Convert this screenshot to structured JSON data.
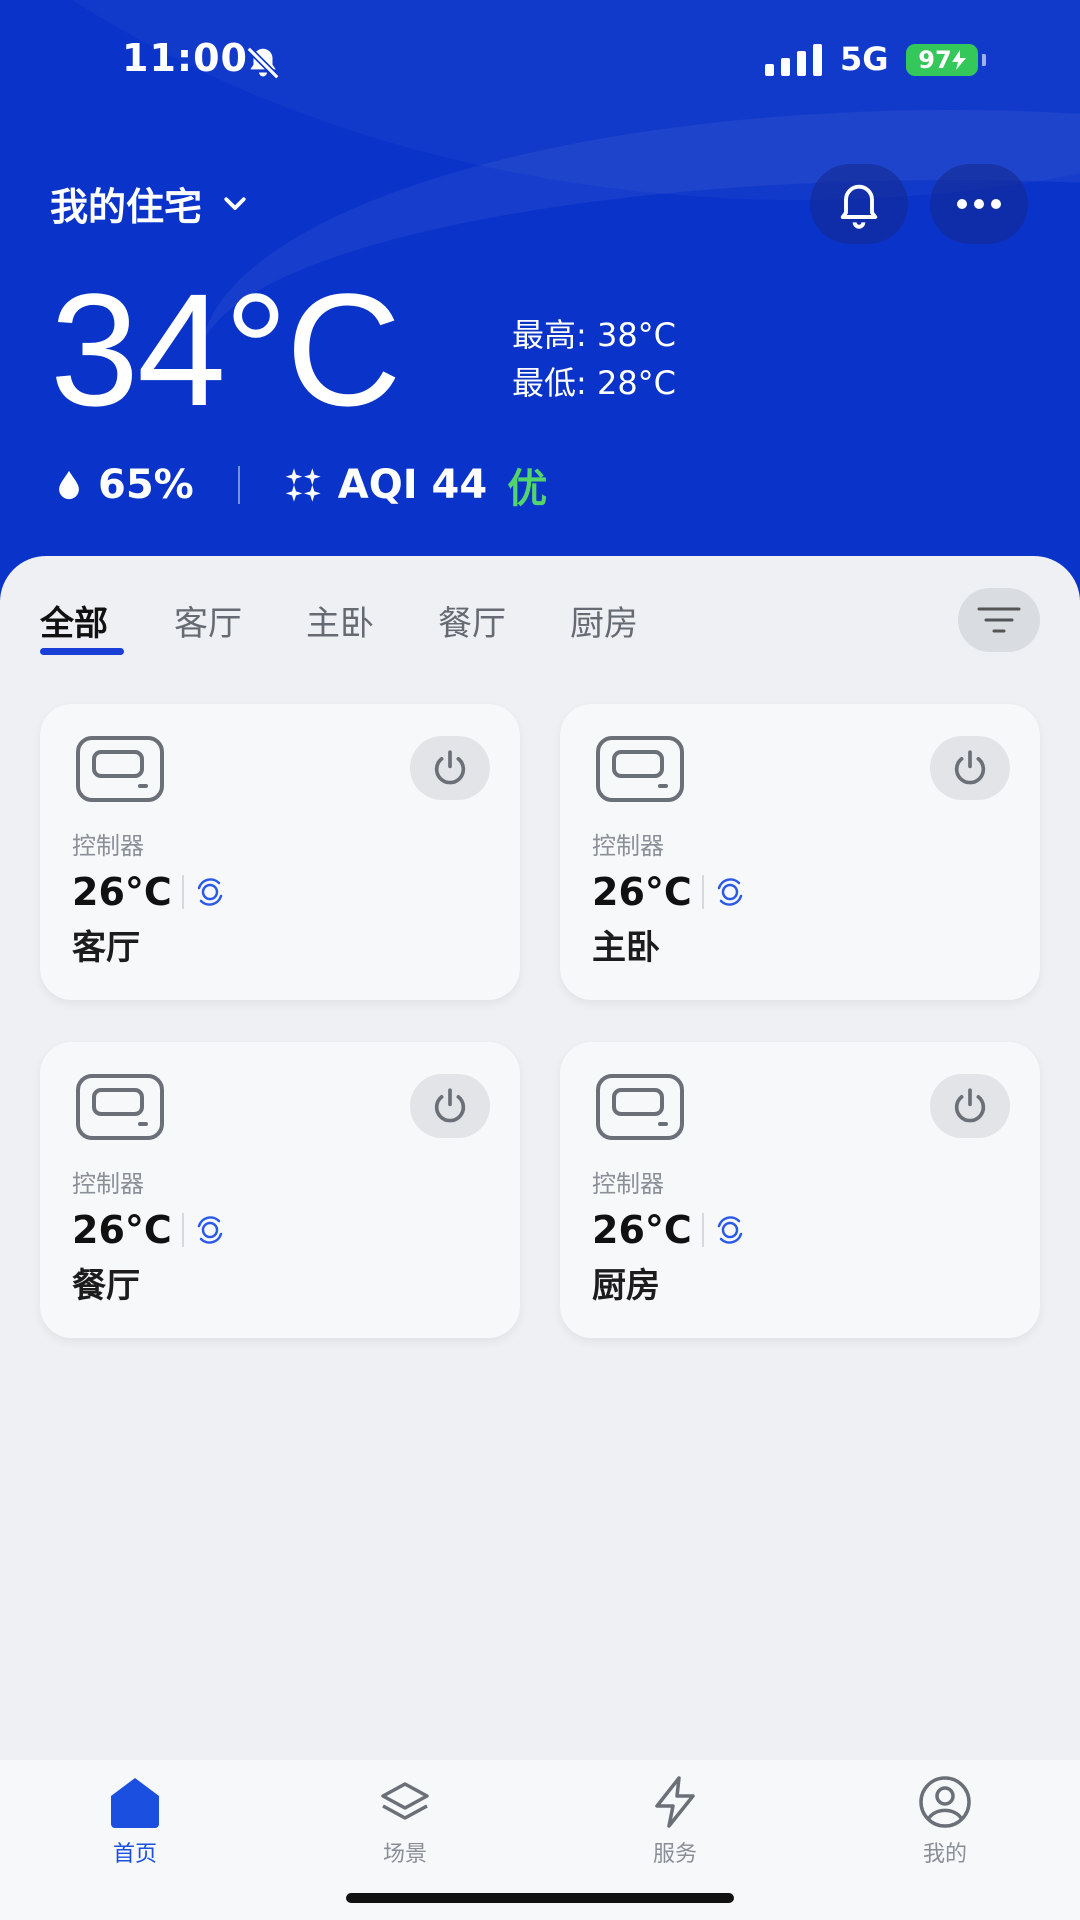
{
  "status_bar": {
    "time": "11:00",
    "network": "5G",
    "battery": "97"
  },
  "header": {
    "home_name": "我的住宅"
  },
  "weather": {
    "current_temp": "34°C",
    "high": "最高: 38°C",
    "low": "最低: 28°C",
    "humidity": "65%",
    "aqi": "AQI 44",
    "aqi_rating": "优"
  },
  "tabs": [
    {
      "label": "全部"
    },
    {
      "label": "客厅"
    },
    {
      "label": "主卧"
    },
    {
      "label": "餐厅"
    },
    {
      "label": "厨房"
    }
  ],
  "devices": [
    {
      "type": "控制器",
      "temp": "26°C",
      "room": "客厅"
    },
    {
      "type": "控制器",
      "temp": "26°C",
      "room": "主卧"
    },
    {
      "type": "控制器",
      "temp": "26°C",
      "room": "餐厅"
    },
    {
      "type": "控制器",
      "temp": "26°C",
      "room": "厨房"
    }
  ],
  "nav": [
    {
      "label": "首页",
      "icon": "home-icon"
    },
    {
      "label": "场景",
      "icon": "layers-icon"
    },
    {
      "label": "服务",
      "icon": "lightning-icon"
    },
    {
      "label": "我的",
      "icon": "user-icon"
    }
  ],
  "colors": {
    "hero_bg": "#0a33c9",
    "accent": "#1a3fd6",
    "aqi_good": "#52d56b",
    "battery": "#34c759"
  }
}
